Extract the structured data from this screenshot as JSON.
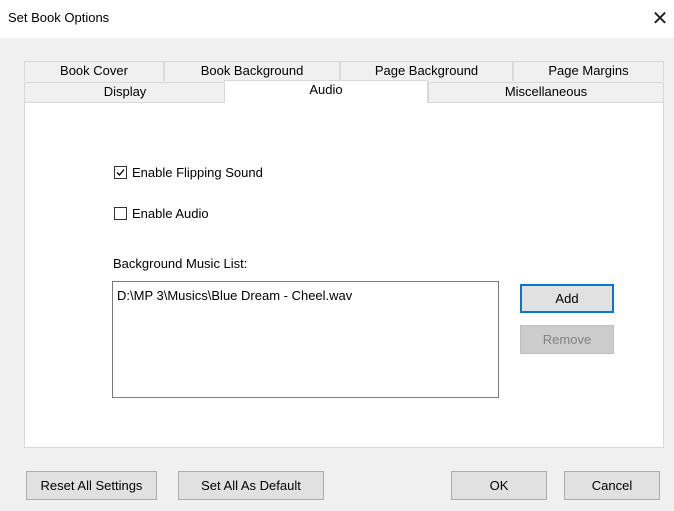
{
  "window": {
    "title": "Set Book Options",
    "close_symbol": "✕"
  },
  "tabs": {
    "row_back": [
      "Book Cover",
      "Book Background",
      "Page Background",
      "Page Margins"
    ],
    "row_front": [
      "Display",
      "Audio",
      "Miscellaneous"
    ],
    "active": "Audio"
  },
  "audio": {
    "flip_sound_label": "Enable Flipping Sound",
    "flip_sound_checked": true,
    "audio_label": "Enable Audio",
    "audio_checked": false,
    "music_list_label": "Background Music List:",
    "music_list": [
      "D:\\MP 3\\Musics\\Blue Dream - Cheel.wav"
    ],
    "add_label": "Add",
    "remove_label": "Remove"
  },
  "footer": {
    "reset_label": "Reset All Settings",
    "default_label": "Set All As Default",
    "ok_label": "OK",
    "cancel_label": "Cancel"
  },
  "colors": {
    "focus_accent": "#0078d7",
    "window_bg": "#f0f0f0"
  }
}
